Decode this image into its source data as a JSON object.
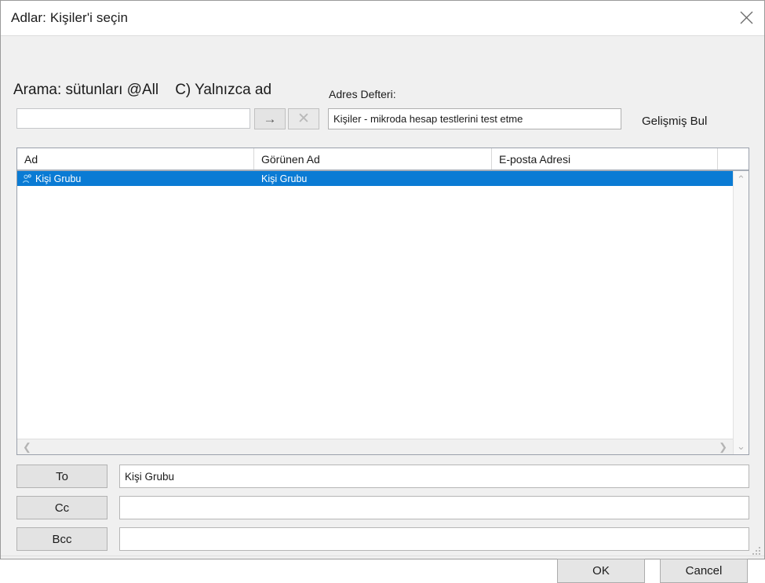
{
  "window": {
    "title": "Adlar: Kişiler'i seçin",
    "close_icon": "close-icon"
  },
  "search": {
    "label": "Arama: sütunları @All    C) Yalnızca ad",
    "input_value": "",
    "input_placeholder": "",
    "go_icon": "arrow-right-icon",
    "clear_icon": "close-x-icon"
  },
  "address_book": {
    "label": "Adres Defteri:",
    "selected": "Kişiler - mikroda hesap testlerini test etme",
    "advanced_find": "Gelişmiş Bul"
  },
  "list": {
    "columns": [
      "Ad",
      "Görünen Ad",
      "E-posta Adresi",
      ""
    ],
    "rows": [
      {
        "icon": "contact-group-icon",
        "name": "Kişi Grubu",
        "display_name": "Kişi Grubu",
        "email": ""
      }
    ],
    "scroll": {
      "up_icon": "chevron-up-icon",
      "down_icon": "chevron-down-icon",
      "left_icon": "chevron-left-icon",
      "right_icon": "chevron-right-icon"
    }
  },
  "recipients": [
    {
      "button": "To",
      "value": "Kişi Grubu"
    },
    {
      "button": "Cc",
      "value": ""
    },
    {
      "button": "Bcc",
      "value": ""
    }
  ],
  "footer": {
    "ok": "OK",
    "cancel": "Cancel"
  },
  "colors": {
    "selection_blue": "#0a7bd4",
    "dialog_bg": "#f0f0f0",
    "titlebar_bg": "#ffffff"
  }
}
